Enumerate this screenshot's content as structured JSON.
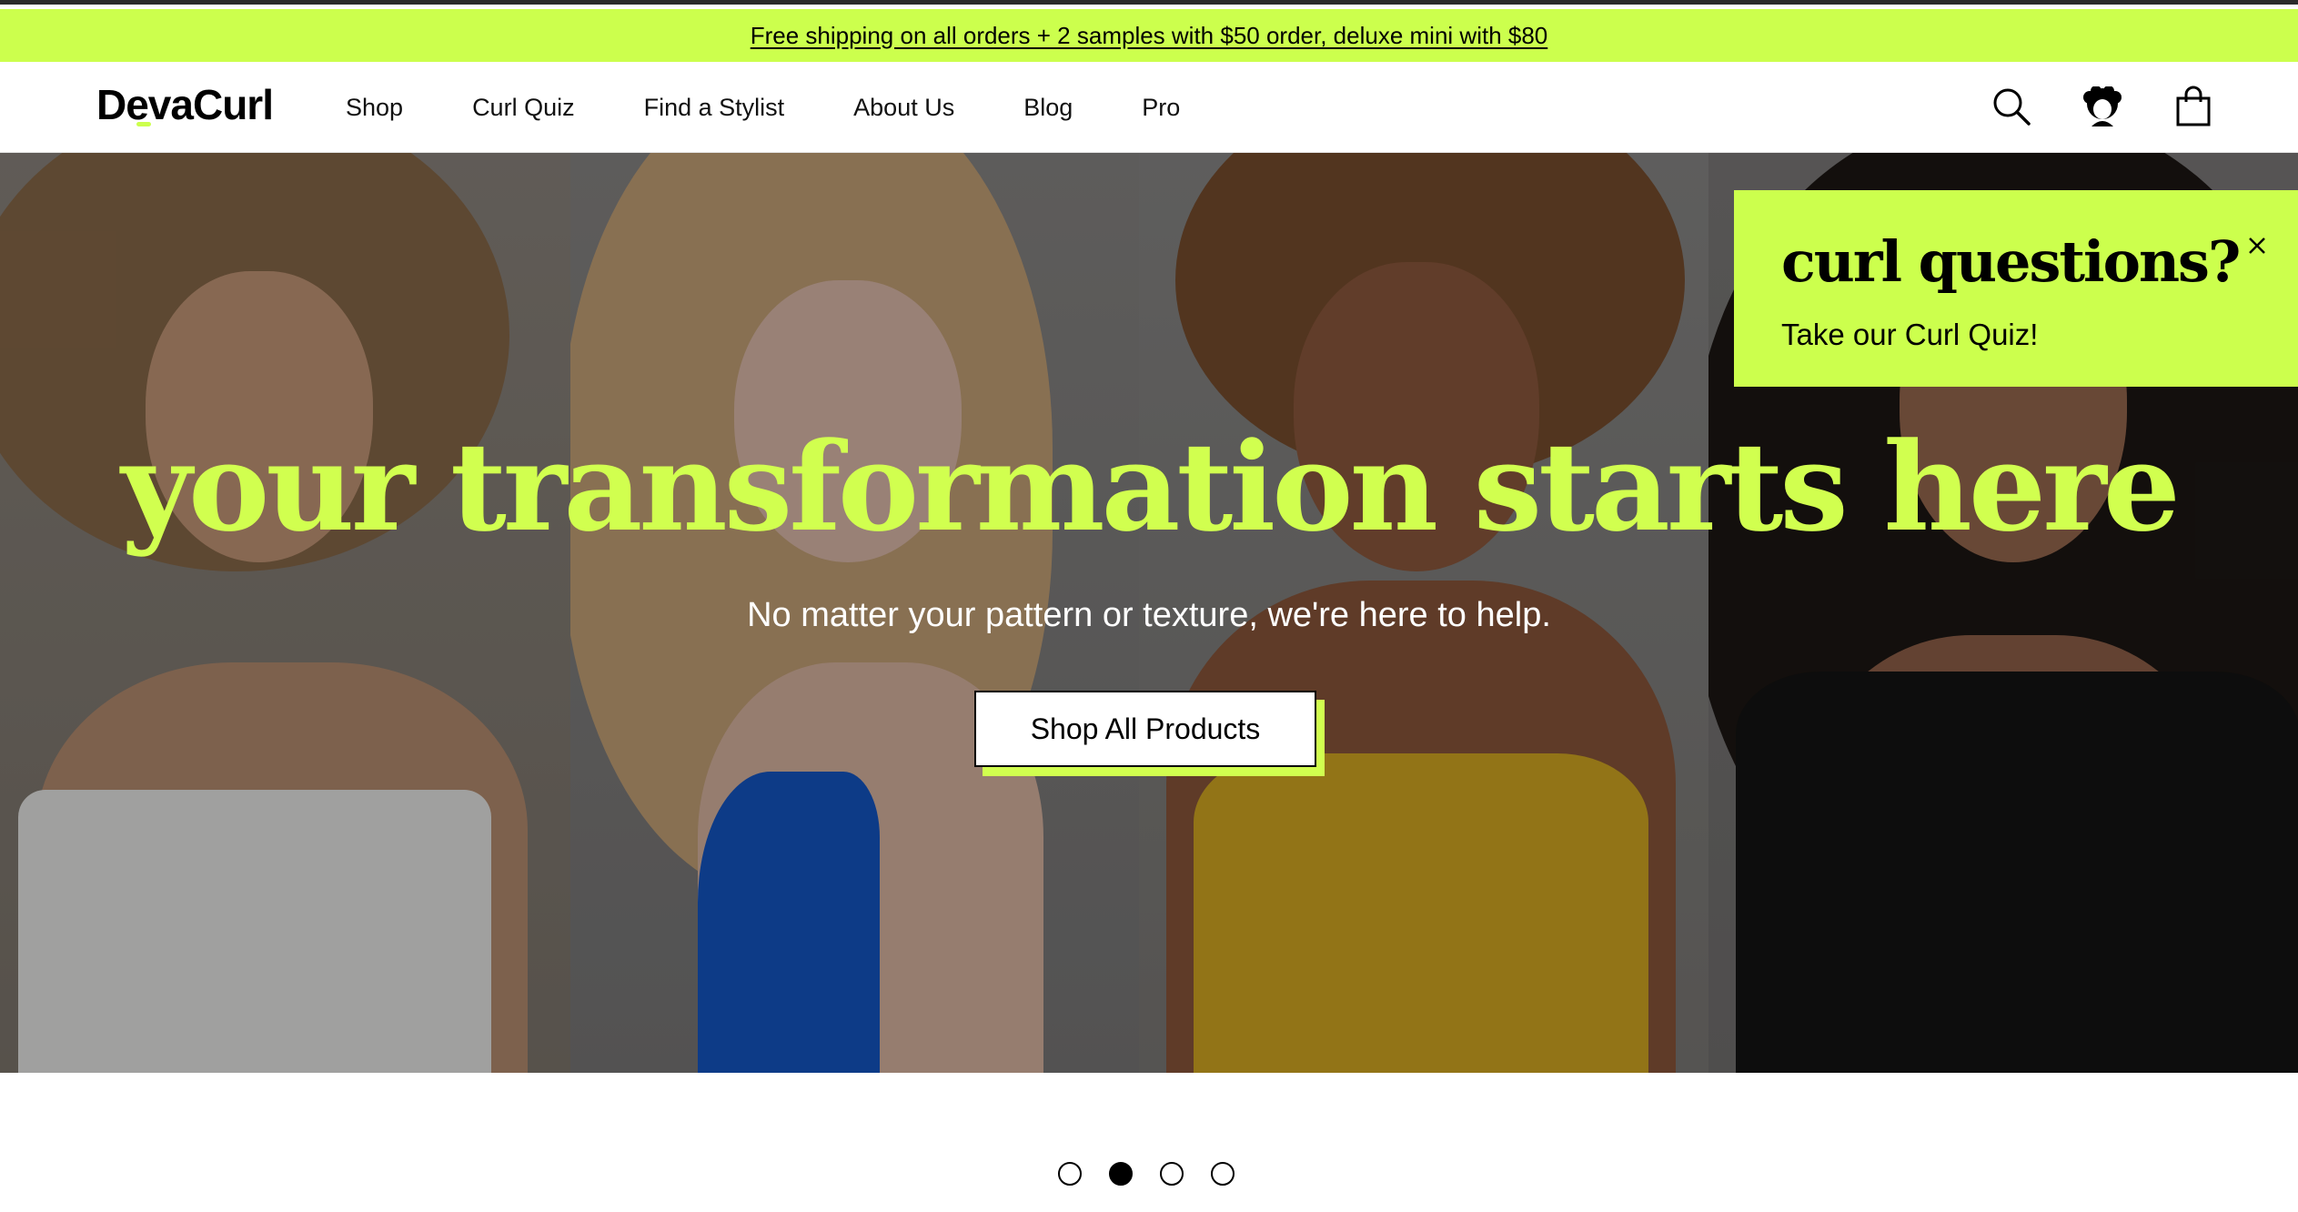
{
  "promo": {
    "text": "Free shipping on all orders + 2 samples with $50 order, deluxe mini with $80"
  },
  "header": {
    "logo": "DevaCurl",
    "nav": [
      {
        "label": "Shop"
      },
      {
        "label": "Curl Quiz"
      },
      {
        "label": "Find a Stylist"
      },
      {
        "label": "About Us"
      },
      {
        "label": "Blog"
      },
      {
        "label": "Pro"
      }
    ],
    "icons": [
      "search-icon",
      "account-icon",
      "shopping-bag-icon"
    ]
  },
  "hero": {
    "headline": "your transformation starts here",
    "subhead": "No matter your pattern or texture, we're here to help.",
    "cta": "Shop All Products"
  },
  "popup": {
    "title": "curl questions?",
    "subtitle": "Take our Curl Quiz!"
  },
  "carousel": {
    "slide_count": 4,
    "active_index": 1
  },
  "colors": {
    "accent": "#ccff4d",
    "text": "#000000",
    "background": "#ffffff"
  }
}
